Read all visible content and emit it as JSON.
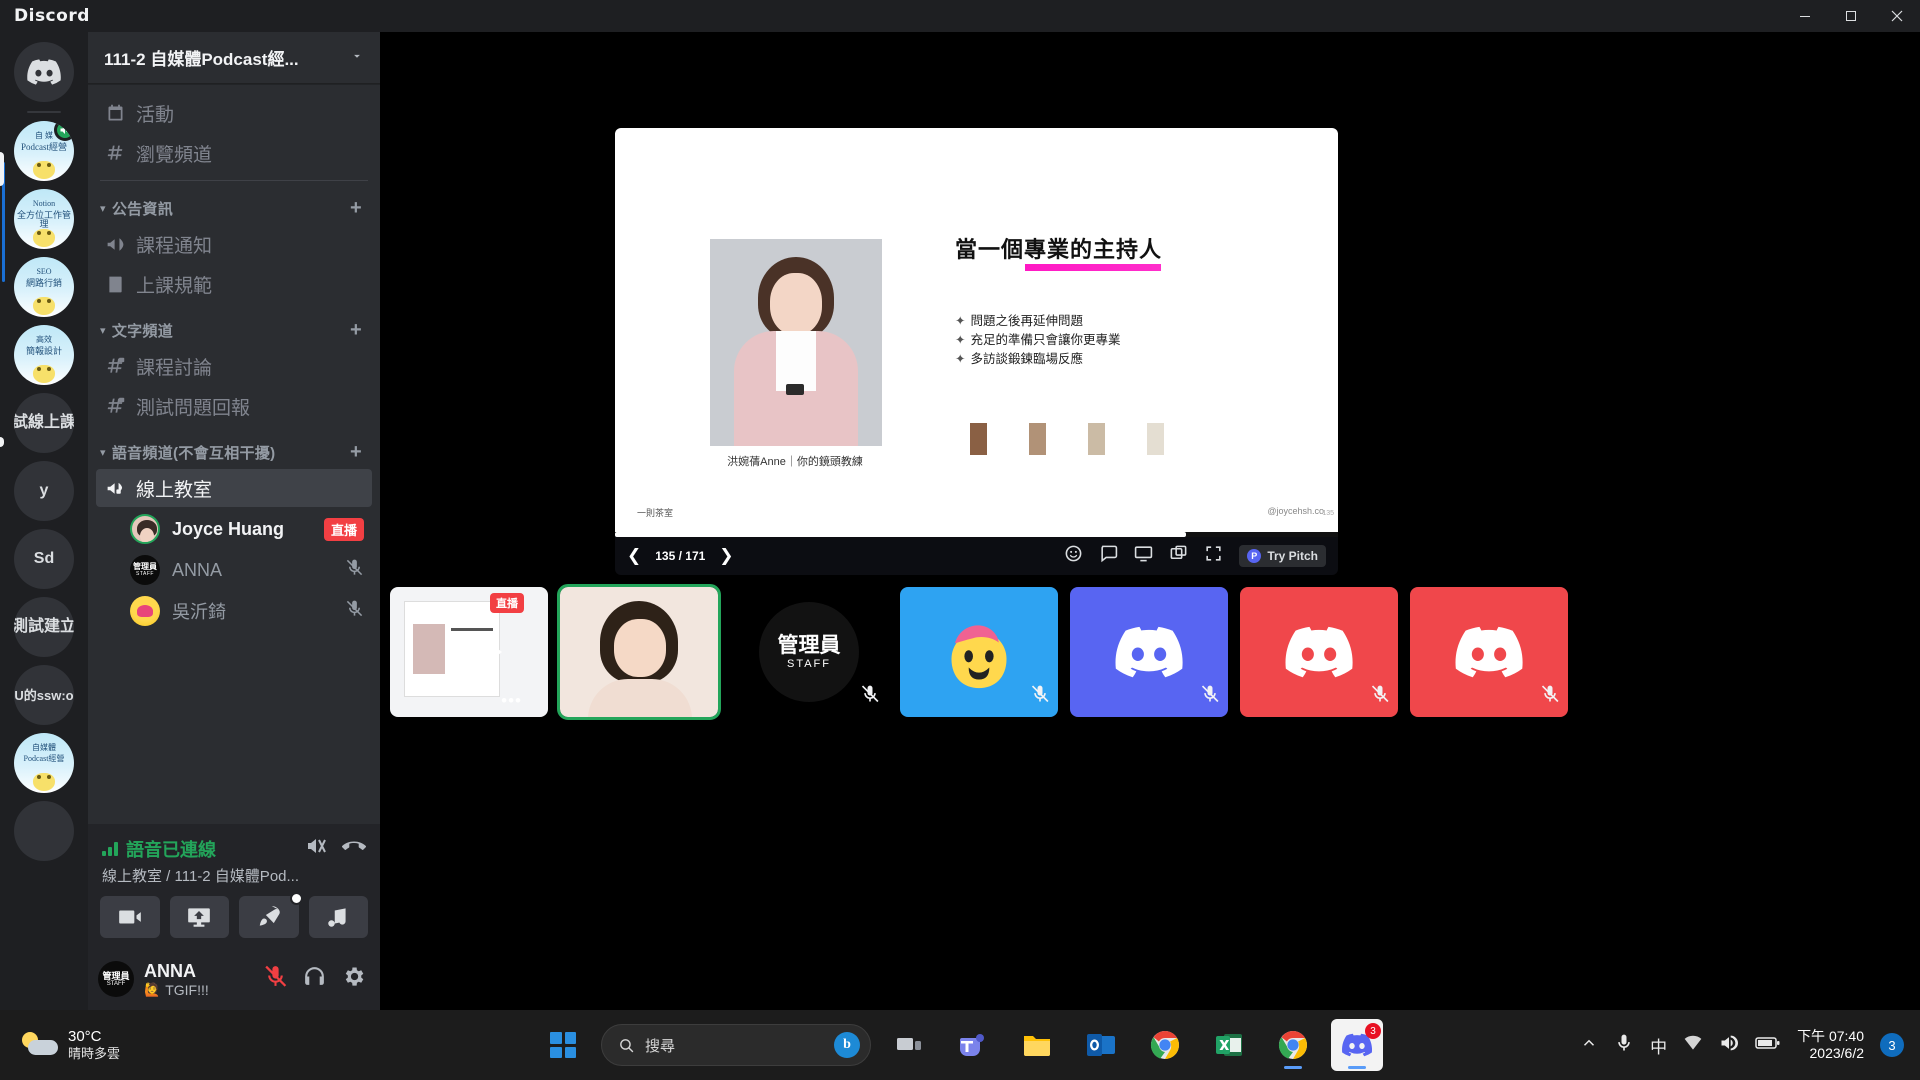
{
  "window": {
    "app_title": "Discord",
    "controls": {
      "minimize": "—",
      "maximize": "▢",
      "close": "✕"
    }
  },
  "server_rail": {
    "home_icon": "discord-home-icon",
    "servers": [
      {
        "name": "自媒體Podcast經營",
        "line1": "自 媒",
        "line2": "Podcast經營",
        "type": "photo",
        "active": true,
        "voice_badge": true
      },
      {
        "name": "Notion 全方位工作管理",
        "line1": "Notion",
        "line2": "全方位工作管理",
        "type": "photo"
      },
      {
        "name": "SEO 網路行銷",
        "line1": "SEO",
        "line2": "網路行銷",
        "type": "photo"
      },
      {
        "name": "高效簡報設計",
        "line1": "高效",
        "line2": "簡報設計",
        "type": "photo"
      },
      {
        "name": "試線上課",
        "label": "試線上課",
        "type": "text",
        "hovered": true
      },
      {
        "name": "y",
        "label": "y",
        "type": "text"
      },
      {
        "name": "Sd",
        "label": "Sd",
        "type": "text"
      },
      {
        "name": "測試建立",
        "label": "測試建立",
        "type": "text"
      },
      {
        "name": "U的ssw:o",
        "label": "U的ssw:o",
        "type": "text"
      },
      {
        "name": "自媒體Podcast經營",
        "line1": "自媒體",
        "line2": "Podcast經營",
        "type": "photo"
      }
    ]
  },
  "sidebar": {
    "guild_name": "111-2 自媒體Podcast經...",
    "chevron": "chevron-down-icon",
    "top_items": [
      {
        "label": "活動",
        "icon": "calendar-icon"
      },
      {
        "label": "瀏覽頻道",
        "icon": "browse-channels-icon"
      }
    ],
    "categories": [
      {
        "label": "公告資訊",
        "add_label": "+",
        "channels": [
          {
            "label": "課程通知",
            "icon": "announcement-icon"
          },
          {
            "label": "上課規範",
            "icon": "rules-icon"
          }
        ]
      },
      {
        "label": "文字頻道",
        "add_label": "+",
        "channels": [
          {
            "label": "課程討論",
            "icon": "hash-lock-icon"
          },
          {
            "label": "測試問題回報",
            "icon": "hash-lock-icon"
          }
        ]
      },
      {
        "label": "語音頻道(不會互相干擾)",
        "add_label": "+",
        "channels": [
          {
            "label": "線上教室",
            "icon": "voice-lock-icon",
            "active": true
          }
        ]
      }
    ],
    "voice_members": [
      {
        "name": "Joyce Huang",
        "avatar": "joyce-avatar",
        "badge": "直播",
        "speaking": true
      },
      {
        "name": "ANNA",
        "avatar": "staff-avatar",
        "muted": true
      },
      {
        "name": "吳沂錡",
        "avatar": "yellow-avatar",
        "muted": true
      }
    ]
  },
  "voice_panel": {
    "status": "語音已連線",
    "location": "線上教室 / 111-2 自媒體Pod...",
    "icons": {
      "noise": "noise-suppression-icon",
      "disconnect": "disconnect-call-icon"
    },
    "buttons": [
      {
        "name": "camera",
        "icon": "video-camera-icon"
      },
      {
        "name": "share-screen",
        "icon": "share-screen-icon"
      },
      {
        "name": "activities",
        "icon": "rocket-icon",
        "has_dot": true
      },
      {
        "name": "soundboard",
        "icon": "soundboard-icon"
      }
    ]
  },
  "user_bar": {
    "username": "ANNA",
    "status_emoji": "🙋",
    "status_text": "TGIF!!!",
    "controls": [
      {
        "name": "mute-microphone",
        "icon": "mic-muted-icon"
      },
      {
        "name": "deafen",
        "icon": "headphones-icon"
      },
      {
        "name": "user-settings",
        "icon": "gear-icon"
      }
    ]
  },
  "stage": {
    "slide": {
      "title": "當一個專業的主持人",
      "bullets": [
        "問題之後再延伸問題",
        "充足的準備只會讓你更專業",
        "多訪談鍛鍊臨場反應"
      ],
      "bullet_mark": "✦",
      "caption": "洪婉蒨Anne｜你的鏡頭教練",
      "footer_left": "一則茶室",
      "footer_right": "@joycehsh.co",
      "footer_number": "135",
      "swatches": [
        "#8a6044",
        "#b19277",
        "#cbbba5",
        "#e4ded2"
      ],
      "underline_color": "#ff19c4"
    },
    "controls": {
      "prev": "❮",
      "next": "❯",
      "page": "135 / 171",
      "progress_percent": 79,
      "right_icons": [
        {
          "name": "emoji",
          "icon": "emoji-icon"
        },
        {
          "name": "chat",
          "icon": "chat-bubble-icon"
        },
        {
          "name": "screen",
          "icon": "monitor-icon"
        },
        {
          "name": "popout",
          "icon": "popout-icon"
        },
        {
          "name": "fullscreen",
          "icon": "fullscreen-icon"
        }
      ],
      "try_pitch_label": "Try Pitch",
      "try_pitch_icon": "pitch-logo-icon"
    },
    "tiles": [
      {
        "name": "shared-screen-tile",
        "kind": "mini-slide",
        "badge": "直播",
        "has_camera_overlay": true,
        "has_dots": true
      },
      {
        "name": "girl-camera-tile",
        "kind": "girl",
        "selected": true
      },
      {
        "name": "anna-staff-tile",
        "kind": "staff",
        "line1": "管理員",
        "line2": "STAFF",
        "muted": true
      },
      {
        "name": "blue-avatar-tile",
        "kind": "blue",
        "muted": true
      },
      {
        "name": "indigo-discord-tile",
        "kind": "indigo",
        "muted": false
      },
      {
        "name": "red-discord-tile-1",
        "kind": "red",
        "muted": true
      },
      {
        "name": "red-discord-tile-2",
        "kind": "red",
        "muted": true
      }
    ]
  },
  "taskbar": {
    "weather": {
      "temperature": "30°C",
      "condition": "晴時多雲",
      "icon": "sun-cloud-icon"
    },
    "start_label": "start-button",
    "search": {
      "placeholder": "搜尋",
      "value": "",
      "icon": "search-icon",
      "bing_label": "b"
    },
    "apps": [
      {
        "name": "task-view",
        "icon": "task-view-icon"
      },
      {
        "name": "microsoft-teams",
        "icon": "teams-icon"
      },
      {
        "name": "file-explorer",
        "icon": "folder-icon"
      },
      {
        "name": "outlook",
        "icon": "outlook-icon"
      },
      {
        "name": "google-chrome",
        "icon": "chrome-icon"
      },
      {
        "name": "microsoft-excel",
        "icon": "excel-icon"
      },
      {
        "name": "chrome-window",
        "icon": "chrome-icon",
        "active": true
      },
      {
        "name": "discord",
        "icon": "discord-icon",
        "active": true
      }
    ],
    "tray": {
      "chevron": "show-hidden-icons",
      "mic": "microphone-icon",
      "ime": "中",
      "wifi": "wifi-icon",
      "volume": "volume-icon",
      "battery": "battery-icon"
    },
    "clock": {
      "time": "下午 07:40",
      "date": "2023/6/2"
    },
    "notification_count": "3"
  }
}
